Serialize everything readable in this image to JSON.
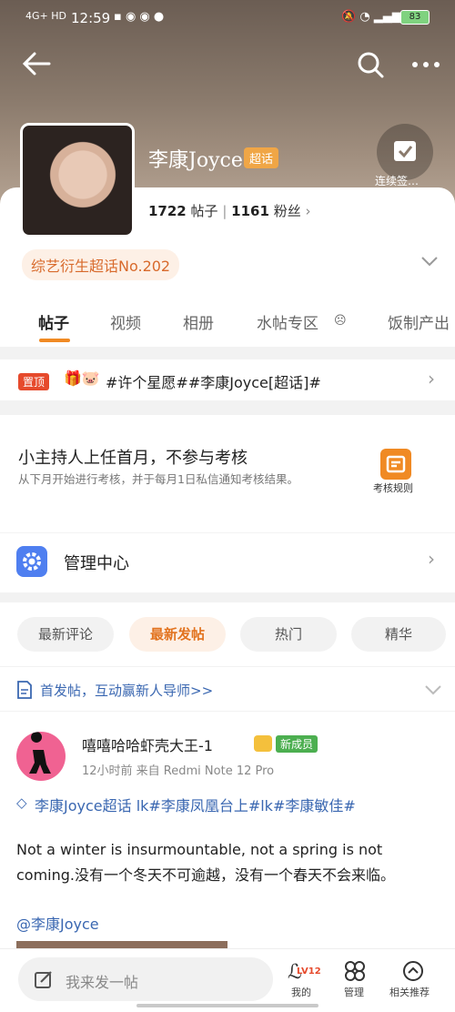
{
  "status_bar": {
    "network": "4G+ HD",
    "time": "12:59",
    "battery": "83"
  },
  "header": {
    "name": "李康Joyce",
    "super_badge": "超话",
    "signin_label": "连续签…",
    "posts_count": "1722",
    "posts_label": "帖子",
    "fans_count": "1161",
    "fans_label": "粉丝",
    "rank_tag": "综艺衍生超话No.202"
  },
  "tabs": [
    "帖子",
    "视频",
    "相册",
    "水帖专区",
    "饭制产出"
  ],
  "pinned": {
    "tag": "置顶",
    "text": "#许个星愿##李康Joyce[超话]#"
  },
  "notice": {
    "title": "小主持人上任首月，不参与考核",
    "subtitle": "从下月开始进行考核，并于每月1日私信通知考核结果。",
    "rules_label": "考核规则"
  },
  "manage": {
    "label": "管理中心"
  },
  "filters": [
    "最新评论",
    "最新发帖",
    "热门",
    "精华"
  ],
  "first_post_tip": "首发帖，互动赢新人导师>>",
  "post": {
    "author": "嘻嘻哈哈虾壳大王-1",
    "newbie_badge": "新成员",
    "meta": "12小时前  来自 Redmi Note 12 Pro",
    "topics": "李康Joyce超话 lk#李康凤凰台上#lk#李康敏佳#",
    "text": "Not a winter is insurmountable, not a spring is not coming.没有一个冬天不可逾越，没有一个春天不会来临。",
    "mention": "@李康Joyce"
  },
  "bottom_bar": {
    "compose_placeholder": "我来发一帖",
    "level": "LV12",
    "me_label": "我的",
    "manage_label": "管理",
    "related_label": "相关推荐"
  },
  "colors": {
    "accent": "#f08a24",
    "link": "#3a67b1",
    "pin_red": "#e64a2c"
  }
}
